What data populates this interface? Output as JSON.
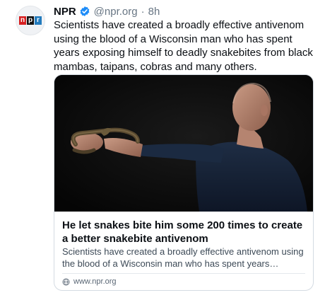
{
  "post": {
    "author_name": "NPR",
    "handle": "@npr.org",
    "separator": "·",
    "time": "8h",
    "avatar_logo": {
      "letters": [
        "n",
        "p",
        "r"
      ],
      "colors": [
        "#d62021",
        "#111111",
        "#237bbd"
      ]
    },
    "verified_icon": "verified-check-icon",
    "text": "Scientists have created a broadly effective antivenom using the blood of a Wisconsin man who has spent years exposing himself to deadly snakebites from black mambas, taipans, cobras and many others."
  },
  "link_card": {
    "image_icon": "photo-man-holding-snake",
    "title": "He let snakes bite him some 200 times to create a better snakebite antivenom",
    "description": "Scientists have created a broadly effective antivenom using the blood of a Wisconsin man who has spent years exposin...",
    "source_icon": "globe-icon",
    "source": "www.npr.org"
  },
  "colors": {
    "verified_blue": "#1d8cf8",
    "muted_text": "#687684",
    "card_border": "#d4dbe2"
  }
}
